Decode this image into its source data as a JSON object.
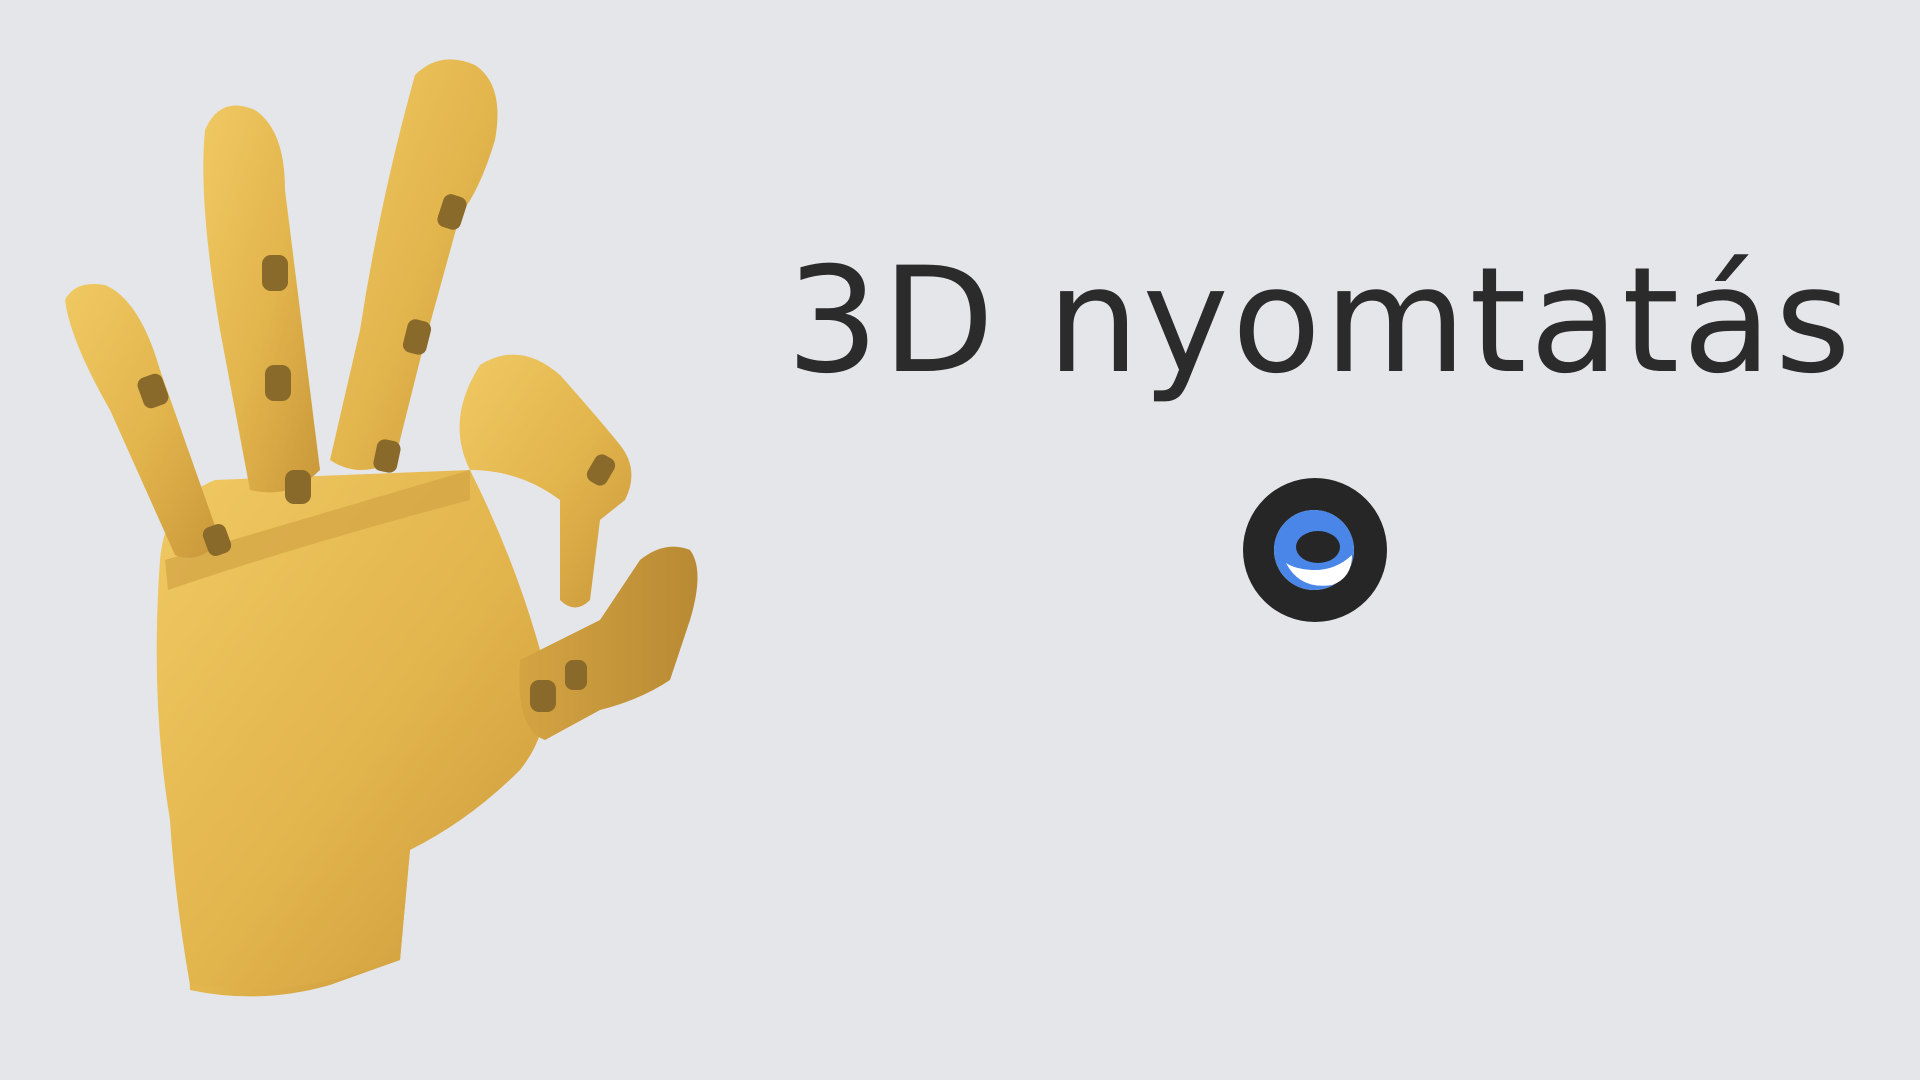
{
  "banner": {
    "title": "3D nyomtatás",
    "image": "3d-printed-robotic-hand-ok-gesture",
    "logo_icon": "brand-logo-icon"
  },
  "colors": {
    "background": "#e5e6ea",
    "title_text": "#2b2b2b",
    "hand_gold": "#e2b44c",
    "logo_dark": "#262626",
    "logo_blue": "#4a86e8",
    "logo_white": "#ffffff"
  }
}
